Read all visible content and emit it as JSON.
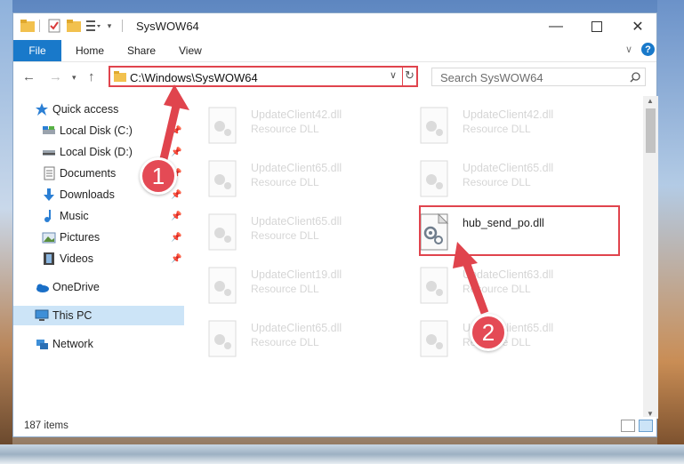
{
  "window": {
    "title": "SysWOW64"
  },
  "ribbon": {
    "file": "File",
    "tabs": [
      "Home",
      "Share",
      "View"
    ]
  },
  "address": {
    "path": "C:\\Windows\\SysWOW64"
  },
  "search": {
    "placeholder": "Search SysWOW64"
  },
  "nav": {
    "items": [
      {
        "label": "Quick access",
        "icon": "star-icon",
        "pinned": false
      },
      {
        "label": "Local Disk (C:)",
        "icon": "drive-icon",
        "pinned": true
      },
      {
        "label": "Local Disk (D:)",
        "icon": "drive-icon",
        "pinned": true
      },
      {
        "label": "Documents",
        "icon": "documents-icon",
        "pinned": true
      },
      {
        "label": "Downloads",
        "icon": "download-icon",
        "pinned": true
      },
      {
        "label": "Music",
        "icon": "music-icon",
        "pinned": true
      },
      {
        "label": "Pictures",
        "icon": "pictures-icon",
        "pinned": true
      },
      {
        "label": "Videos",
        "icon": "videos-icon",
        "pinned": true
      },
      {
        "label": "OneDrive",
        "icon": "cloud-icon",
        "pinned": false
      },
      {
        "label": "This PC",
        "icon": "computer-icon",
        "pinned": false
      },
      {
        "label": "Network",
        "icon": "network-icon",
        "pinned": false
      }
    ]
  },
  "files": [
    {
      "name": "UpdateClient42.dll",
      "type": "Resource DLL"
    },
    {
      "name": "UpdateClient42.dll",
      "type": "Resource DLL"
    },
    {
      "name": "UpdateClient65.dll",
      "type": "Resource DLL"
    },
    {
      "name": "UpdateClient65.dll",
      "type": "Resource DLL"
    },
    {
      "name": "UpdateClient65.dll",
      "type": "Resource DLL"
    },
    {
      "name": "hub_send_po.dll",
      "type": ""
    },
    {
      "name": "UpdateClient19.dll",
      "type": "Resource DLL"
    },
    {
      "name": "UpdateClient63.dll",
      "type": "Resource DLL"
    },
    {
      "name": "UpdateClient65.dll",
      "type": "Resource DLL"
    },
    {
      "name": "UpdateClient65.dll",
      "type": "Resource DLL"
    }
  ],
  "status": {
    "count": "187 items"
  },
  "callouts": [
    "1",
    "2"
  ],
  "colors": {
    "accent": "#1979ca",
    "highlight": "#e0444d"
  }
}
